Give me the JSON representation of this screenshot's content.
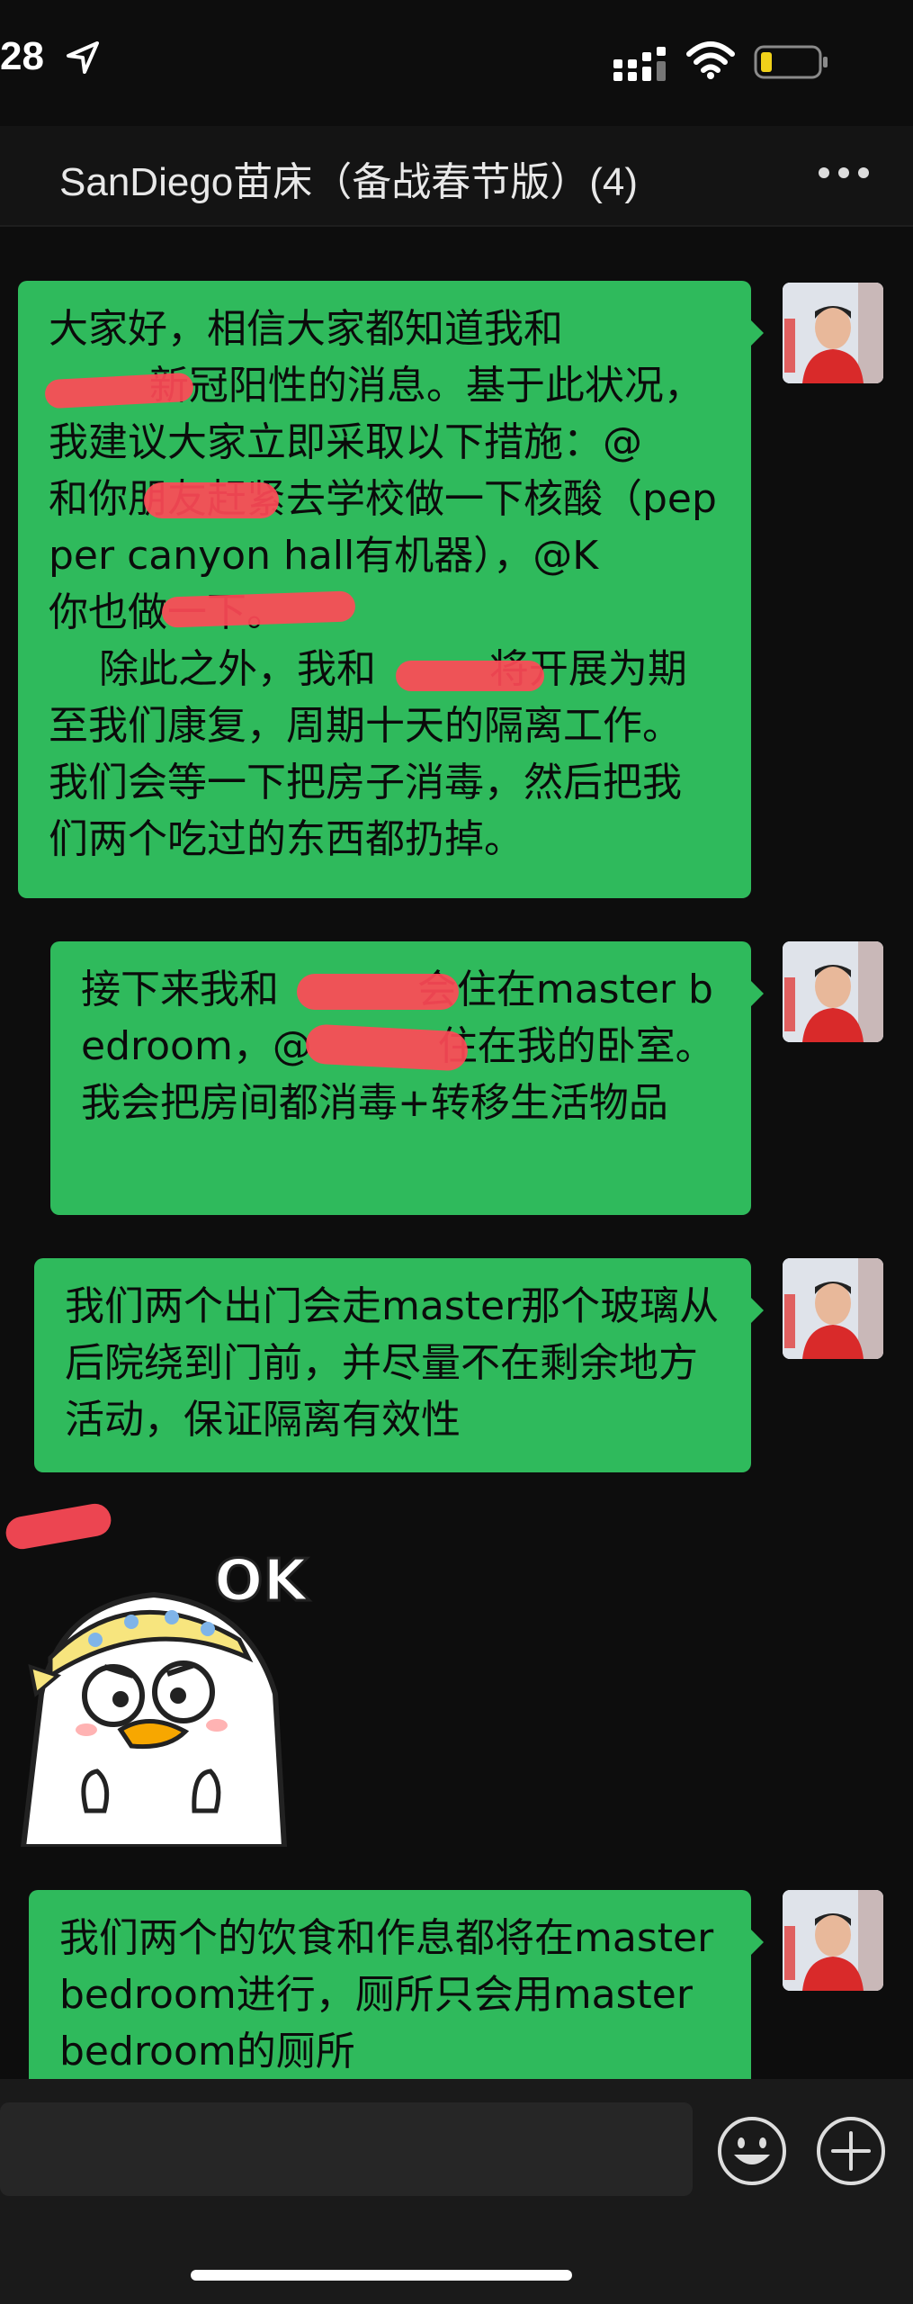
{
  "status_bar": {
    "time": "28"
  },
  "header": {
    "title": "SanDiego苗床（备战春节版）(4)"
  },
  "messages": [
    {
      "text": "大家好，相信大家都知道我和\n        新冠阳性的消息。基于此状况，我建议大家立即采取以下措施：@      和你朋友赶紧去学校做一下核酸（pepper canyon hall有机器），@K         你也做一下。\n    除此之外，我和         将开展为期至我们康复，周期十天的隔离工作。我们会等一下把房子消毒，然后把我们两个吃过的东西都扔掉。"
    },
    {
      "text": "接下来我和           会住在master bedroom，@          住在我的卧室。我会把房间都消毒+转移生活物品"
    },
    {
      "text": "我们两个出门会走master那个玻璃从后院绕到门前，并尽量不在剩余地方活动，保证隔离有效性"
    },
    {
      "text": "我们两个的饮食和作息都将在master bedroom进行，厕所只会用master bedroom的厕所"
    }
  ],
  "sticker": {
    "caption": "OK"
  },
  "colors": {
    "bubble": "#2fba5c",
    "background": "#0d0d0d",
    "redaction": "#ff4a57"
  }
}
